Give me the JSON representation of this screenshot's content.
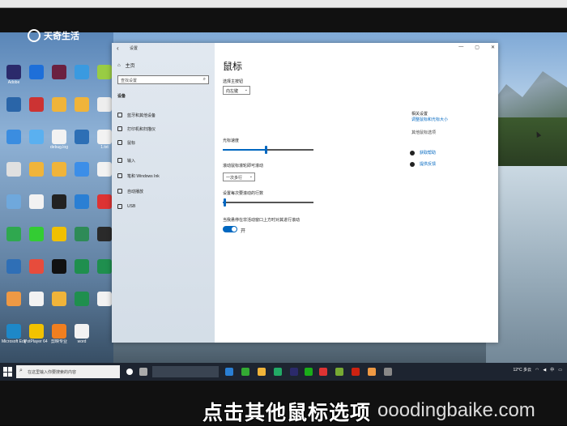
{
  "watermark": {
    "logo_text": "天奇生活"
  },
  "window": {
    "title": "设置",
    "controls": [
      "—",
      "▢",
      "✕"
    ]
  },
  "sidebar": {
    "home": "主页",
    "search_placeholder": "查找设置",
    "section": "设备",
    "items": [
      {
        "label": "蓝牙和其他设备",
        "icon": "bluetooth-icon"
      },
      {
        "label": "打印机和扫描仪",
        "icon": "printer-icon"
      },
      {
        "label": "鼠标",
        "icon": "mouse-icon"
      },
      {
        "label": "输入",
        "icon": "keyboard-icon"
      },
      {
        "label": "笔和 Windows Ink",
        "icon": "pen-icon"
      },
      {
        "label": "自动播放",
        "icon": "autoplay-icon"
      },
      {
        "label": "USB",
        "icon": "usb-icon"
      }
    ]
  },
  "main": {
    "title": "鼠标",
    "primary_button_label": "选择主按钮",
    "primary_button_value": "向左键",
    "cursor_speed_label": "光标速度",
    "cursor_speed_level": 0.47,
    "wheel_scroll_label": "滚动鼠标滚轮即可滚动",
    "wheel_scroll_value": "一次多行",
    "lines_label": "设置每次要滚动的行数",
    "lines_level": 0.02,
    "inactive_scroll_label": "当我悬停在非活动窗口上方时对其进行滚动",
    "inactive_scroll_state": "开"
  },
  "related": {
    "heading": "相关设置",
    "link1": "调整鼠标和光标大小",
    "link2": "其他鼠标选项",
    "help": "获取帮助",
    "feedback": "提供反馈"
  },
  "taskbar": {
    "search_placeholder": "在这里输入你要搜索的内容",
    "weather": "12°C 多云",
    "lang": "中"
  },
  "caption": "点击其他鼠标选项",
  "site_watermark": "ooodingbaike.com",
  "desktop_icons": [
    "Adobe",
    "",
    "",
    "",
    "",
    "",
    "",
    "debug.log",
    "",
    "1.txt",
    "",
    "",
    "",
    "",
    "",
    "",
    "",
    "",
    "",
    "",
    "",
    "",
    "",
    "",
    "",
    "",
    "",
    "",
    "",
    "",
    "Microsoft Edge",
    "PotPlayer 64 bit",
    "剪映专业",
    "word"
  ]
}
